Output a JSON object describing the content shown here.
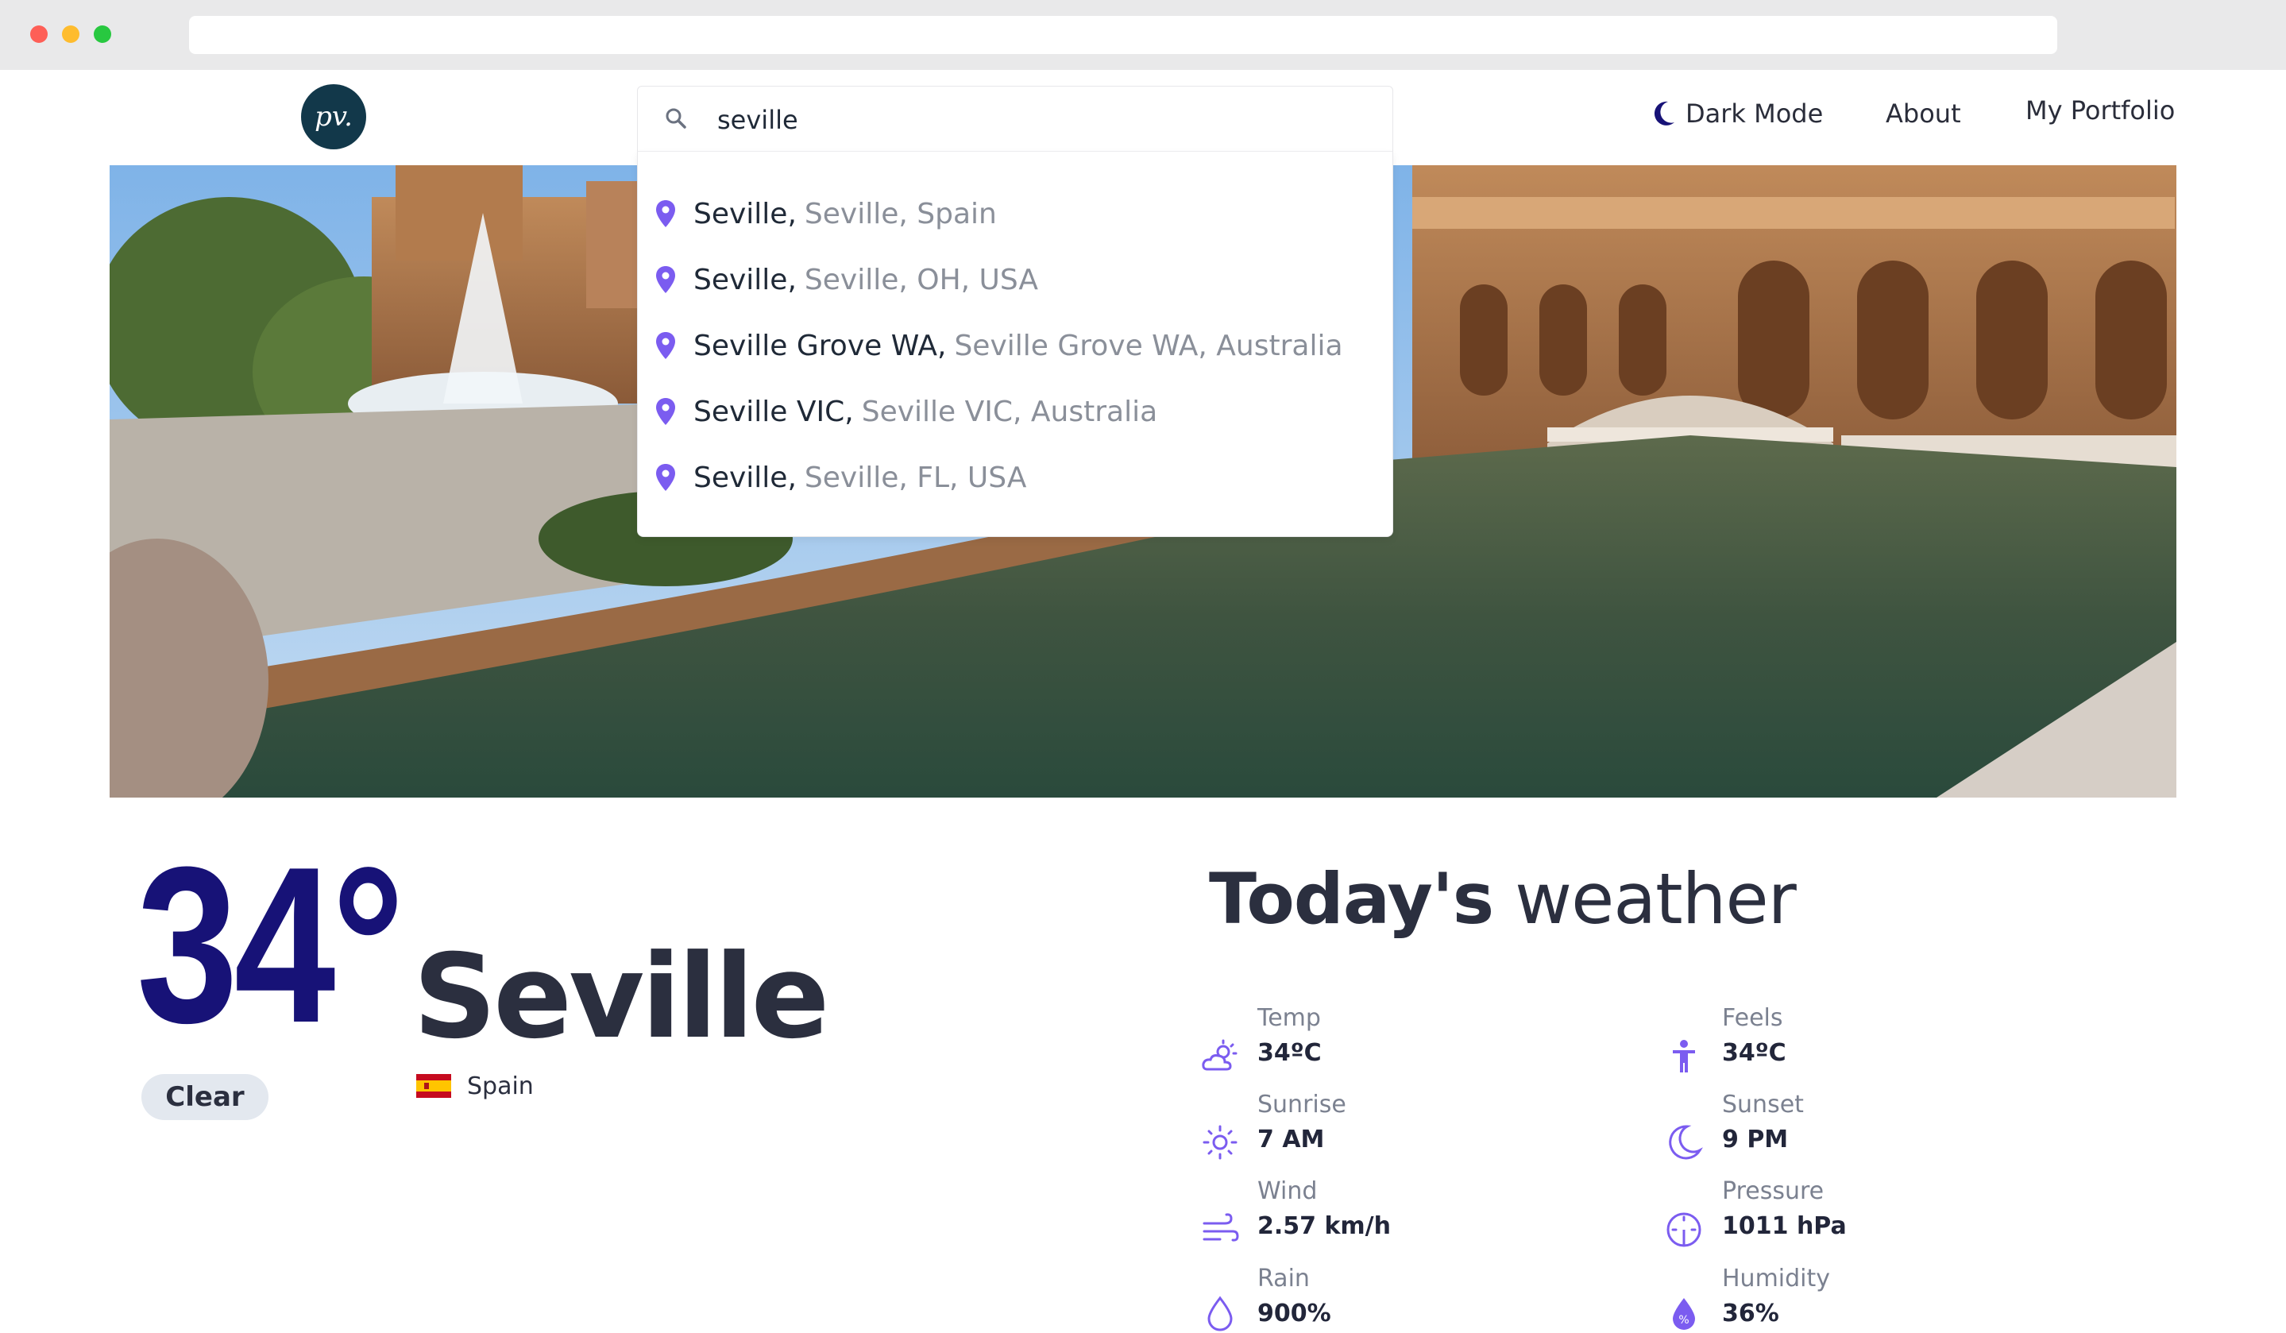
{
  "header": {
    "logo_text": "pv.",
    "nav": {
      "dark_mode": "Dark Mode",
      "about": "About",
      "portfolio": "My Portfolio"
    }
  },
  "search": {
    "value": "seville",
    "suggestions": [
      {
        "main": "Seville,",
        "secondary": "Seville, Spain"
      },
      {
        "main": "Seville,",
        "secondary": "Seville, OH, USA"
      },
      {
        "main": "Seville Grove WA,",
        "secondary": "Seville Grove WA, Australia"
      },
      {
        "main": "Seville VIC,",
        "secondary": "Seville VIC, Australia"
      },
      {
        "main": "Seville,",
        "secondary": "Seville, FL, USA"
      }
    ]
  },
  "current": {
    "temperature": "34°",
    "city": "Seville",
    "condition": "Clear",
    "country": "Spain"
  },
  "today": {
    "title_bold": "Today's",
    "title_rest": " weather",
    "stats": [
      {
        "label": "Temp",
        "value": "34ºC",
        "icon": "cloud-sun-icon"
      },
      {
        "label": "Feels",
        "value": "34ºC",
        "icon": "person-icon"
      },
      {
        "label": "Sunrise",
        "value": "7 AM",
        "icon": "sun-icon"
      },
      {
        "label": "Sunset",
        "value": "9 PM",
        "icon": "moon-icon"
      },
      {
        "label": "Wind",
        "value": "2.57 km/h",
        "icon": "wind-icon"
      },
      {
        "label": "Pressure",
        "value": "1011 hPa",
        "icon": "gauge-icon"
      },
      {
        "label": "Rain",
        "value": "900%",
        "icon": "droplet-icon"
      },
      {
        "label": "Humidity",
        "value": "36%",
        "icon": "humidity-icon"
      }
    ]
  },
  "colors": {
    "accent": "#7b5cf0",
    "temp_color": "#171277",
    "logo_bg": "#12384a"
  }
}
